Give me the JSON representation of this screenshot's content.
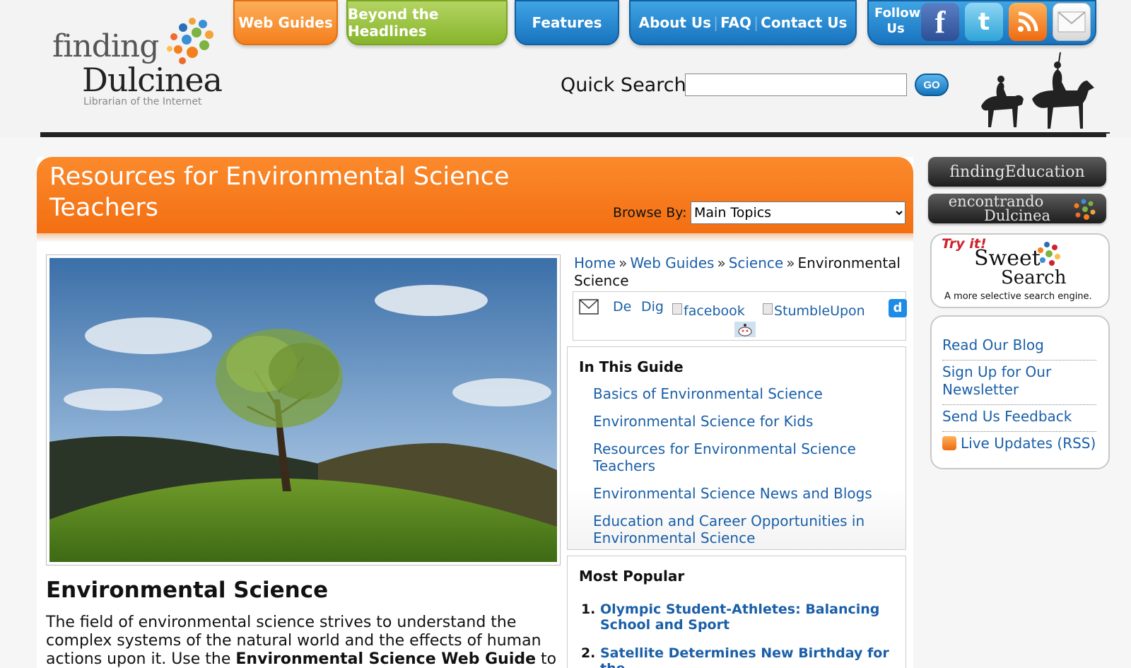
{
  "logo": {
    "line1": "finding",
    "line2": "Dulcinea",
    "tagline": "Librarian of the Internet"
  },
  "nav": {
    "web_guides": "Web Guides",
    "beyond": "Beyond the Headlines",
    "features": "Features",
    "about": "About Us",
    "faq": "FAQ",
    "contact": "Contact Us"
  },
  "follow": {
    "label_line1": "Follow",
    "label_line2": "Us",
    "icons": [
      "facebook-icon",
      "twitter-icon",
      "rss-icon",
      "email-icon"
    ]
  },
  "search": {
    "label": "Quick Search",
    "value": "",
    "go": "GO"
  },
  "banner": {
    "title": "Resources for Environmental Science Teachers",
    "browse_label": "Browse By:",
    "browse_selected": "Main Topics"
  },
  "breadcrumb": {
    "home": "Home",
    "web_guides": "Web Guides",
    "science": "Science",
    "current": "Environmental Science"
  },
  "share": {
    "delicious": "De",
    "digg": "Dig",
    "facebook": "facebook",
    "stumbleupon": "StumbleUpon"
  },
  "guide": {
    "title": "In This Guide",
    "items": [
      "Basics of Environmental Science",
      "Environmental Science for Kids",
      "Resources for Environmental Science Teachers",
      "Environmental Science News and Blogs",
      "Education and Career Opportunities in Environmental Science"
    ]
  },
  "popular": {
    "title": "Most Popular",
    "items": [
      "Olympic Student-Athletes: Balancing School and Sport",
      "Satellite Determines New Birthday for the"
    ]
  },
  "article": {
    "title": "Environmental Science",
    "intro_part1": "The field of environmental science strives to understand the complex systems of the natural world and the effects of human actions upon it. Use the ",
    "intro_bold": "Environmental Science Web Guide",
    "intro_part2": " to learn the basics of"
  },
  "sidebar": {
    "finding_education": "findingEducation",
    "encontrando_1": "encontrando",
    "encontrando_2": "Dulcinea",
    "sweet_try": "Try it!",
    "sweet_1": "Sweet",
    "sweet_2": "Search",
    "sweet_tag": "A more selective search engine.",
    "links": [
      "Read Our Blog",
      "Sign Up for Our Newsletter",
      "Send Us Feedback",
      "Live Updates (RSS)"
    ]
  },
  "colors": {
    "orange": "#f47f1c",
    "green": "#87b52b",
    "blue": "#1873bf",
    "link": "#1a5fa8"
  }
}
